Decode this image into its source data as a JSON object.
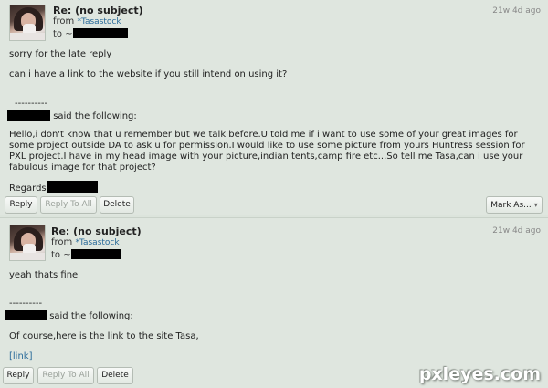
{
  "messages": [
    {
      "subject": "Re: (no subject)",
      "from_label": "from",
      "from_user": "*Tasastock",
      "to_label": "to ~",
      "time": "21w 4d ago",
      "reply_line1": "sorry for the late reply",
      "reply_line2": "can i have a link to the website if you still intend on using it?",
      "divider": "----------",
      "said_following": "said the following:",
      "quoted": "Hello,i don't know that u remember but we talk before.U told me if i want to use some of your great images for some project outside DA to ask u for permission.I would like to use some picture from yours Huntress session for PXL project.I have in my head image with your picture,indian tents,camp fire etc...So tell me Tasa,can i use your fabulous image for that project?",
      "regards": "Regards",
      "buttons": {
        "reply": "Reply",
        "reply_all": "Reply To All",
        "delete": "Delete",
        "mark_as": "Mark As..."
      }
    },
    {
      "subject": "Re: (no subject)",
      "from_label": "from",
      "from_user": "*Tasastock",
      "to_label": "to ~",
      "time": "21w 4d ago",
      "reply_line1": "yeah thats fine",
      "divider": "----------",
      "said_following": "said the following:",
      "quoted": "Of course,here is the link to the site Tasa,",
      "link": "[link]",
      "buttons": {
        "reply": "Reply",
        "reply_all": "Reply To All",
        "delete": "Delete"
      }
    }
  ],
  "watermark": "pxleyes.com",
  "icons": {
    "avatar": "user-avatar",
    "mark_dropdown": "chevron-down-icon"
  },
  "colors": {
    "background": "#dce4dc",
    "link": "#2a6b9a",
    "redaction": "#000000"
  }
}
